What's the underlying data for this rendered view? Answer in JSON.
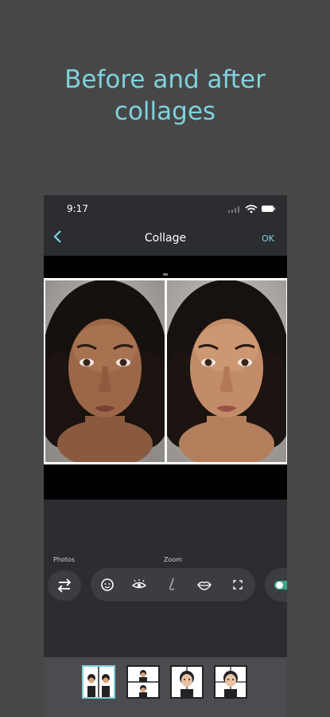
{
  "promo": {
    "line1": "Before and after",
    "line2": "collages"
  },
  "status_bar": {
    "time": "9:17"
  },
  "nav": {
    "back_icon": "chevron-left-icon",
    "title": "Collage",
    "ok_label": "OK"
  },
  "panel": {
    "photos_label": "Photos",
    "zoom_label": "Zoom"
  },
  "tools": [
    {
      "name": "face-icon"
    },
    {
      "name": "eye-icon"
    },
    {
      "name": "nose-icon"
    },
    {
      "name": "lips-icon"
    },
    {
      "name": "fullscreen-icon"
    }
  ],
  "layouts": [
    {
      "name": "layout-side-by-side",
      "selected": true
    },
    {
      "name": "layout-stacked",
      "selected": false
    },
    {
      "name": "layout-quad",
      "selected": false
    },
    {
      "name": "layout-split-face",
      "selected": false
    }
  ],
  "colors": {
    "accent": "#7ed3de",
    "toggle": "#3aa58c",
    "background": "#474747",
    "phone_bg": "#2b2d30"
  }
}
